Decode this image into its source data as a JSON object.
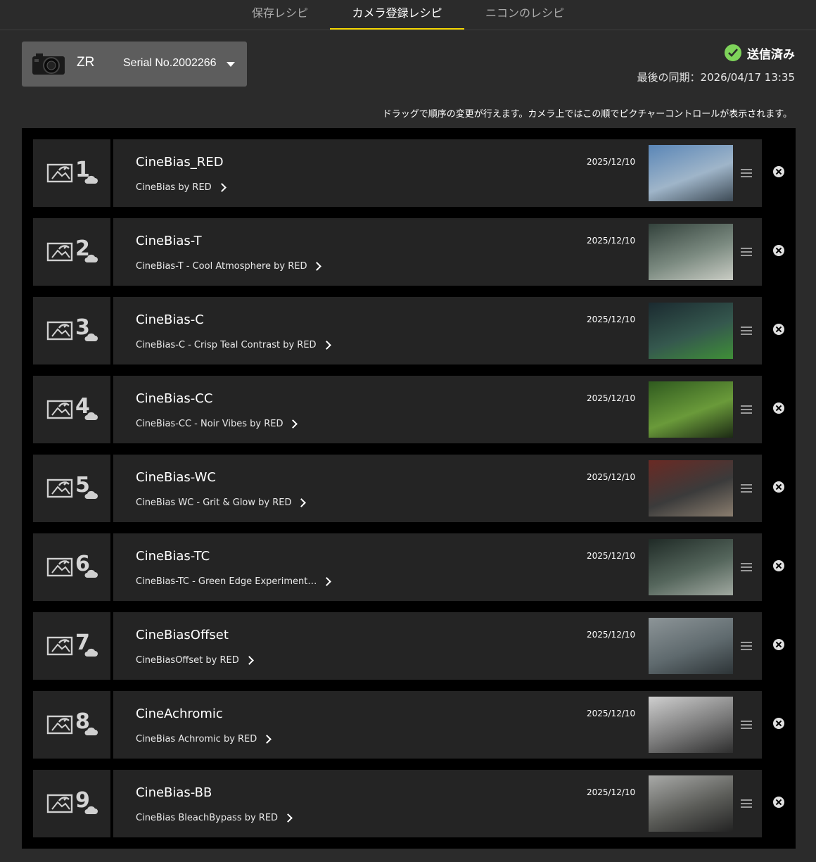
{
  "tabs": [
    {
      "label": "保存レシピ",
      "active": false
    },
    {
      "label": "カメラ登録レシピ",
      "active": true
    },
    {
      "label": "ニコンのレシピ",
      "active": false
    }
  ],
  "camera": {
    "model": "ZR",
    "serial": "Serial No.2002266"
  },
  "status": {
    "label": "送信済み",
    "sync": "最後の同期：2026/04/17 13:35"
  },
  "hint": "ドラッグで順序の変更が行えます。カメラ上ではこの順でピクチャーコントロールが表示されます。",
  "recipes": [
    {
      "num": "1",
      "name": "CineBias_RED",
      "sub": "CineBias by RED",
      "date": "2025/12/10",
      "colors": [
        "#5a86b7",
        "#9fb5c9",
        "#3d4a55"
      ]
    },
    {
      "num": "2",
      "name": "CineBias-T",
      "sub": "CineBias-T - Cool Atmosphere by RED",
      "date": "2025/12/10",
      "colors": [
        "#33423c",
        "#7b8a80",
        "#c9ccc4"
      ]
    },
    {
      "num": "3",
      "name": "CineBias-C",
      "sub": "CineBias-C - Crisp Teal Contrast by RED",
      "date": "2025/12/10",
      "colors": [
        "#1b2a30",
        "#35584e",
        "#3f8f37"
      ]
    },
    {
      "num": "4",
      "name": "CineBias-CC",
      "sub": "CineBias-CC - Noir Vibes by RED",
      "date": "2025/12/10",
      "colors": [
        "#2f5a1f",
        "#6a9a3a",
        "#1c2a14"
      ]
    },
    {
      "num": "5",
      "name": "CineBias-WC",
      "sub": "CineBias WC - Grit & Glow by RED",
      "date": "2025/12/10",
      "colors": [
        "#6a2a24",
        "#3b3b3b",
        "#8a7d6e"
      ]
    },
    {
      "num": "6",
      "name": "CineBias-TC",
      "sub": "CineBias-TC - Green Edge Experiment…",
      "date": "2025/12/10",
      "colors": [
        "#1f2a26",
        "#55665c",
        "#a0a8a0"
      ]
    },
    {
      "num": "7",
      "name": "CineBiasOffset",
      "sub": "CineBiasOffset by RED",
      "date": "2025/12/10",
      "colors": [
        "#8d9598",
        "#5f6a6e",
        "#2d3437"
      ]
    },
    {
      "num": "8",
      "name": "CineAchromic",
      "sub": "CineBias Achromic by RED",
      "date": "2025/12/10",
      "colors": [
        "#cfcfcf",
        "#7a7a7a",
        "#2e2e2e"
      ]
    },
    {
      "num": "9",
      "name": "CineBias-BB",
      "sub": "CineBias BleachBypass by RED",
      "date": "2025/12/10",
      "colors": [
        "#a9aaa8",
        "#5b5c58",
        "#232323"
      ]
    }
  ]
}
